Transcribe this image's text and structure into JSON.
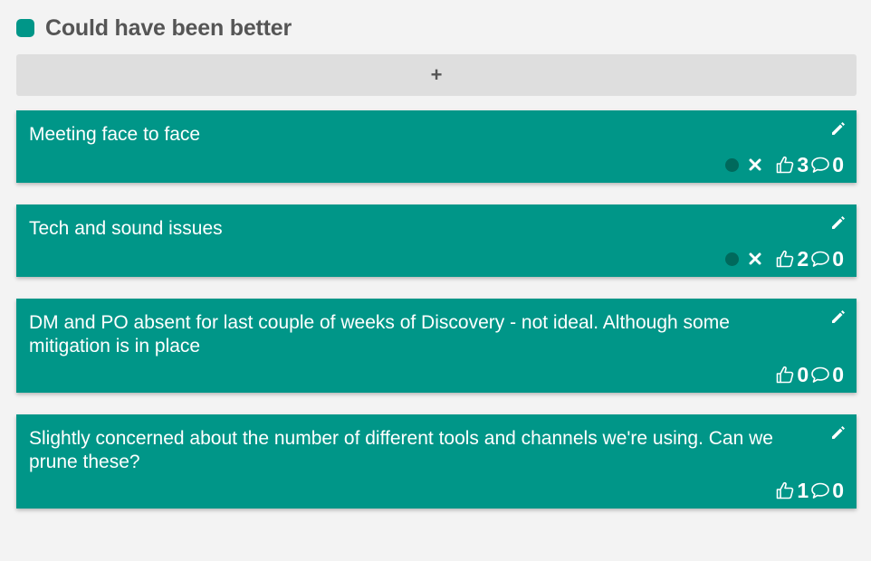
{
  "column": {
    "title": "Could have been better",
    "accent_color": "#009688",
    "add_button_label": "+"
  },
  "colors": {
    "card_bg": "#009688",
    "status_dot": "#00695c",
    "page_bg": "#f3f3f3"
  },
  "cards": [
    {
      "text": "Meeting face to face",
      "likes": "3",
      "comments": "0",
      "has_status_controls": true
    },
    {
      "text": "Tech and sound issues",
      "likes": "2",
      "comments": "0",
      "has_status_controls": true
    },
    {
      "text": "DM and PO absent for last couple of weeks of Discovery - not ideal. Although some mitigation is in place",
      "likes": "0",
      "comments": "0",
      "has_status_controls": false
    },
    {
      "text": "Slightly concerned about the number of different tools and channels we're using. Can we prune these?",
      "likes": "1",
      "comments": "0",
      "has_status_controls": false
    }
  ]
}
